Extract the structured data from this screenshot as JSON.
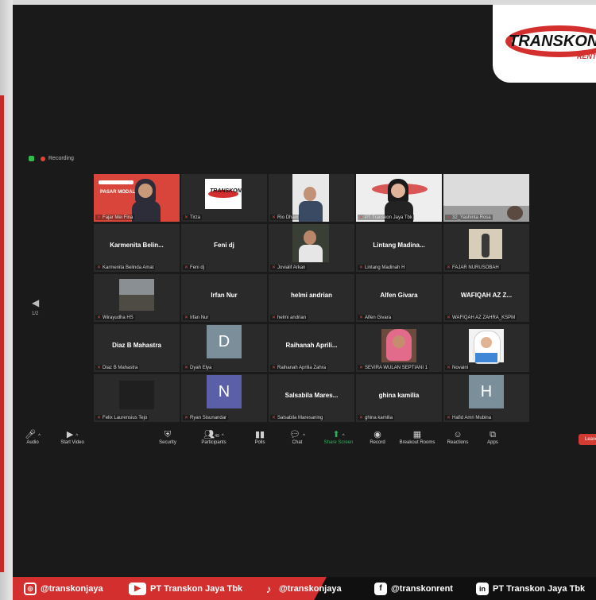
{
  "recording": {
    "label": "Recording"
  },
  "logo": {
    "line1": "TRANSKON",
    "line2": "RENT"
  },
  "pager": {
    "page": "1/2"
  },
  "tiles": [
    {
      "label": "Fajar Mei Fina",
      "title": "",
      "avatar": "",
      "avatar_color": ""
    },
    {
      "label": "Tirza",
      "title": "",
      "avatar": "",
      "avatar_color": ""
    },
    {
      "label": "Rio Dhani",
      "title": "",
      "avatar": "",
      "avatar_color": ""
    },
    {
      "label": "PT Transkon Jaya Tbk",
      "title": "",
      "avatar": "",
      "avatar_color": ""
    },
    {
      "label": "32_Yashinta Rosa",
      "title": "",
      "avatar": "",
      "avatar_color": ""
    },
    {
      "label": "Karmenita Belinda Amat",
      "title": "Karmenita Belin...",
      "avatar": "",
      "avatar_color": ""
    },
    {
      "label": "Feni dj",
      "title": "Feni dj",
      "avatar": "",
      "avatar_color": ""
    },
    {
      "label": "Jovialif Arkan",
      "title": "",
      "avatar": "",
      "avatar_color": ""
    },
    {
      "label": "Lintang Madinah H",
      "title": "Lintang Madina...",
      "avatar": "",
      "avatar_color": ""
    },
    {
      "label": "FAJAR NURUSOBAH",
      "title": "",
      "avatar": "",
      "avatar_color": ""
    },
    {
      "label": "Wirayudha HS",
      "title": "",
      "avatar": "",
      "avatar_color": ""
    },
    {
      "label": "Irfan Nur",
      "title": "Irfan Nur",
      "avatar": "",
      "avatar_color": ""
    },
    {
      "label": "helmi andrian",
      "title": "helmi andrian",
      "avatar": "",
      "avatar_color": ""
    },
    {
      "label": "Alfen Givara",
      "title": "Alfen Givara",
      "avatar": "",
      "avatar_color": ""
    },
    {
      "label": "WAFIQAH AZ ZAHRA_KSPM",
      "title": "WAFIQAH AZ Z...",
      "avatar": "",
      "avatar_color": ""
    },
    {
      "label": "Diaz B Mahastra",
      "title": "Diaz B Mahastra",
      "avatar": "",
      "avatar_color": ""
    },
    {
      "label": "Dyah Elya",
      "title": "",
      "avatar": "D",
      "avatar_color": "#7a8f99"
    },
    {
      "label": "Raihanah Aprilia Zahra",
      "title": "Raihanah Aprili...",
      "avatar": "",
      "avatar_color": ""
    },
    {
      "label": "SEVIRA WULAN SEPTIANI 1",
      "title": "",
      "avatar": "",
      "avatar_color": ""
    },
    {
      "label": "Novaini",
      "title": "",
      "avatar": "",
      "avatar_color": ""
    },
    {
      "label": "Felix Laurensius Tejo",
      "title": "",
      "avatar": "",
      "avatar_color": ""
    },
    {
      "label": "Ryan Sisunandar",
      "title": "",
      "avatar": "N",
      "avatar_color": "#5a5fa8"
    },
    {
      "label": "Salsabila Maresaning",
      "title": "Salsabila Mares...",
      "avatar": "",
      "avatar_color": ""
    },
    {
      "label": "ghina kamilia",
      "title": "ghina kamilia",
      "avatar": "",
      "avatar_color": ""
    },
    {
      "label": "Hafid Amri Mubina",
      "title": "",
      "avatar": "H",
      "avatar_color": "#7a8f99"
    }
  ],
  "toolbar": {
    "audio": "Audio",
    "start_video": "Start Video",
    "security": "Security",
    "participants": "Participants",
    "participants_count": "49",
    "polls": "Polls",
    "chat": "Chat",
    "share_screen": "Share Screen",
    "record": "Record",
    "breakout_rooms": "Breakout Rooms",
    "reactions": "Reactions",
    "apps": "Apps",
    "leave": "Leave"
  },
  "footer": {
    "instagram": "@transkonjaya",
    "youtube": "PT Transkon Jaya Tbk",
    "tiktok": "@transkonjaya",
    "facebook": "@transkonrent",
    "linkedin": "PT Transkon Jaya Tbk"
  },
  "colors": {
    "brand_red": "#d32f2f",
    "share_green": "#2fae5c",
    "active_border": "#e8c33a"
  }
}
